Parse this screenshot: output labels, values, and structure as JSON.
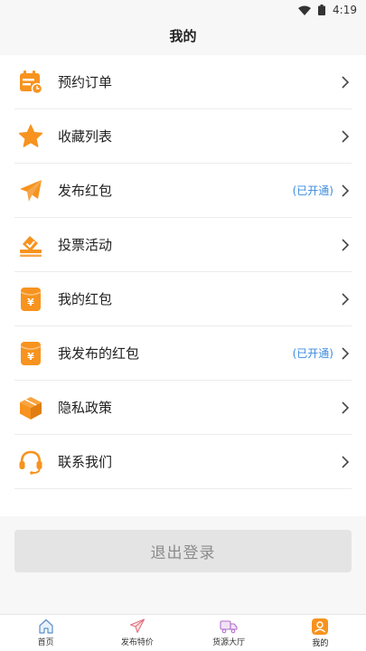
{
  "status_bar": {
    "time": "4:19"
  },
  "header": {
    "title": "我的"
  },
  "menu": {
    "items": [
      {
        "label": "预约订单",
        "icon": "calendar-clock-icon"
      },
      {
        "label": "收藏列表",
        "icon": "star-icon"
      },
      {
        "label": "发布红包",
        "icon": "paper-plane-icon",
        "badge": "(已开通)"
      },
      {
        "label": "投票活动",
        "icon": "ballot-box-icon"
      },
      {
        "label": "我的红包",
        "icon": "red-envelope-icon"
      },
      {
        "label": "我发布的红包",
        "icon": "red-envelope-icon",
        "badge": "(已开通)"
      },
      {
        "label": "隐私政策",
        "icon": "cube-icon"
      },
      {
        "label": "联系我们",
        "icon": "headset-icon"
      }
    ]
  },
  "logout": {
    "label": "退出登录"
  },
  "tabbar": {
    "tabs": [
      {
        "label": "首页",
        "icon": "home-icon"
      },
      {
        "label": "发布特价",
        "icon": "send-icon"
      },
      {
        "label": "货源大厅",
        "icon": "truck-icon"
      },
      {
        "label": "我的",
        "icon": "user-icon",
        "active": true
      }
    ]
  },
  "colors": {
    "accent": "#f7931e",
    "badge": "#3b8be0",
    "logout_bg": "#e4e4e4"
  }
}
